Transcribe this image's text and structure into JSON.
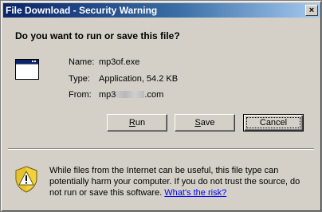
{
  "window": {
    "title": "File Download - Security Warning",
    "close_glyph": "×"
  },
  "dialog": {
    "question": "Do you want to run or save this file?",
    "file_icon": "application-window-icon",
    "fields": {
      "name_label": "Name:",
      "name_value": "mp3of.exe",
      "type_label": "Type:",
      "type_value": "Application, 54.2 KB",
      "from_label": "From:",
      "from_prefix": "mp3",
      "from_suffix": ".com"
    }
  },
  "buttons": {
    "run": {
      "access_key": "R",
      "rest": "un"
    },
    "save": {
      "access_key": "S",
      "rest": "ave"
    },
    "cancel_label": "Cancel"
  },
  "warning": {
    "icon": "shield-warning-icon",
    "text": "While files from the Internet can be useful, this file type can potentially harm your computer. If you do not trust the source, do not run or save this software.",
    "link_text": "What's the risk?"
  },
  "colors": {
    "titlebar_start": "#0a246a",
    "titlebar_end": "#a6caf0",
    "face": "#d4d0c8",
    "link": "#0000ff",
    "shield_yellow": "#f2d23a"
  }
}
